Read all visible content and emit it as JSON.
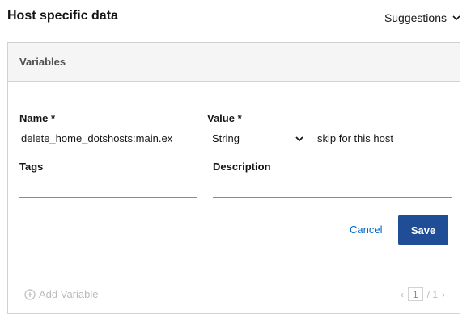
{
  "header": {
    "title": "Host specific data",
    "suggestions_label": "Suggestions"
  },
  "card": {
    "title": "Variables",
    "form": {
      "name_label": "Name *",
      "name_value": "delete_home_dotshosts:main.ex",
      "value_label": "Value *",
      "type_value": "String",
      "value_text": "skip for this host",
      "tags_label": "Tags",
      "tags_value": "",
      "description_label": "Description",
      "description_value": ""
    },
    "actions": {
      "cancel_label": "Cancel",
      "save_label": "Save"
    },
    "footer": {
      "add_variable_label": "Add Variable",
      "prev_symbol": "‹",
      "current_page": "1",
      "total_pages": "/ 1",
      "next_symbol": "›"
    }
  }
}
